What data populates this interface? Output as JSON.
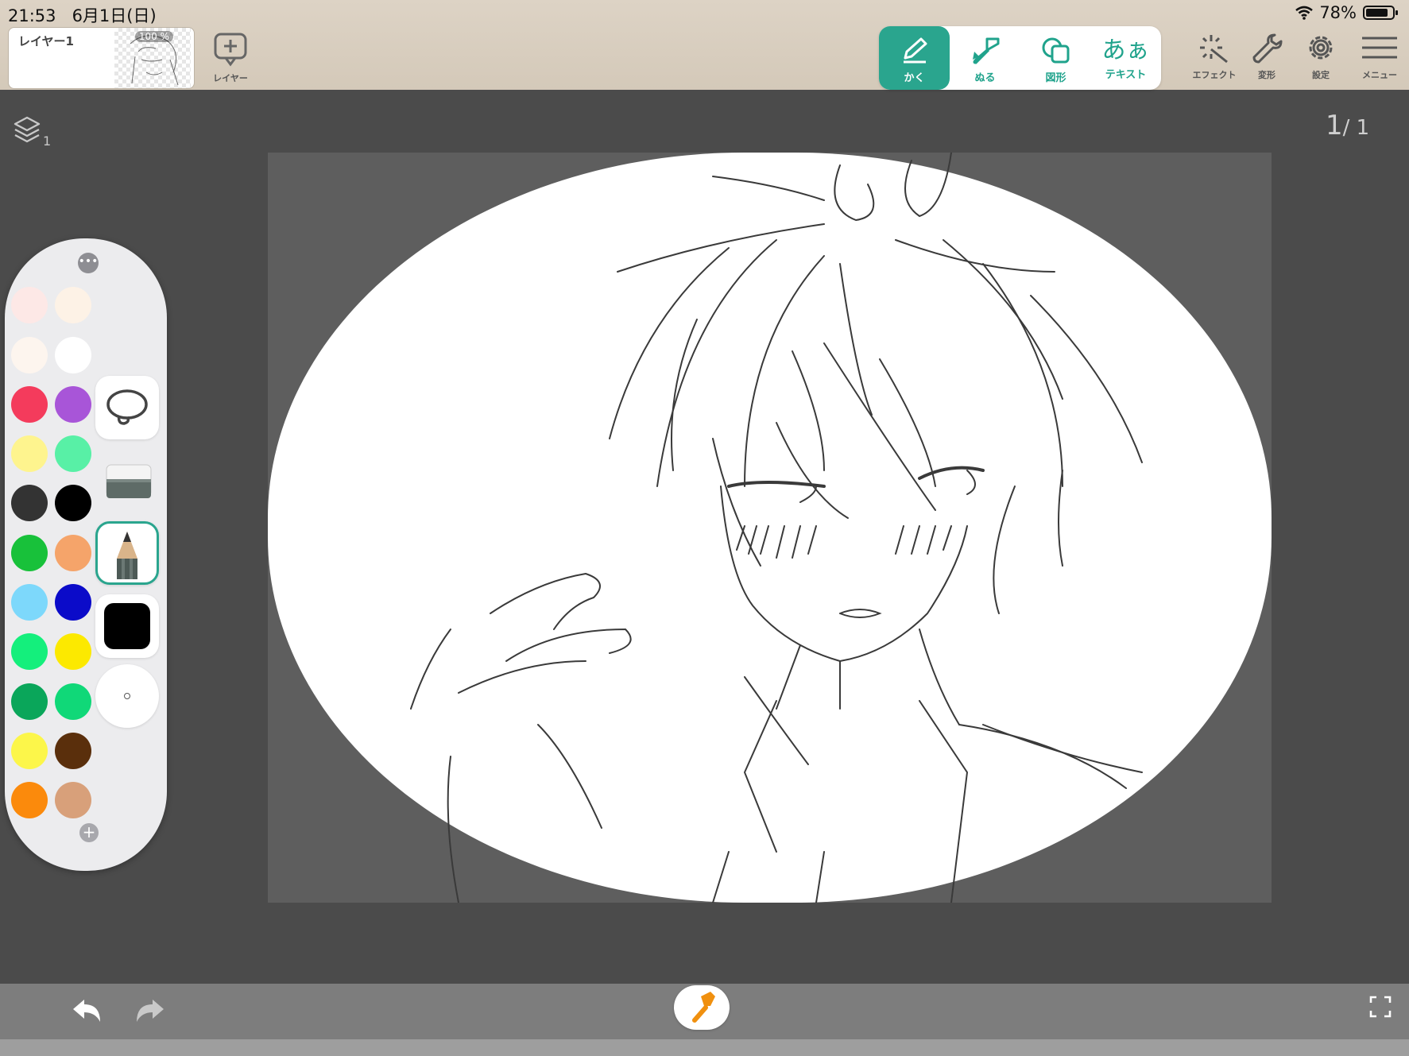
{
  "status_bar": {
    "time": "21:53",
    "date": "6月1日(日)",
    "wifi": "wifi-icon",
    "battery_percent": "78%",
    "battery_level": 0.78
  },
  "layer_panel": {
    "layer_name": "レイヤー1",
    "opacity": "100 %",
    "add_layer_label": "レイヤー"
  },
  "tool_tabs": [
    {
      "label": "かく",
      "icon": "pen-icon",
      "active": true
    },
    {
      "label": "ぬる",
      "icon": "paint-brush-icon",
      "active": false
    },
    {
      "label": "図形",
      "icon": "shapes-icon",
      "active": false
    },
    {
      "label": "テキスト",
      "icon": "text-icon",
      "glyph": "あぁ",
      "active": false
    }
  ],
  "top_actions": [
    {
      "label": "エフェクト",
      "icon": "sparkle-icon"
    },
    {
      "label": "変形",
      "icon": "wrench-icon"
    },
    {
      "label": "設定",
      "icon": "gear-icon"
    },
    {
      "label": "メニュー",
      "icon": "hamburger-icon"
    }
  ],
  "canvas": {
    "layer_count": "1",
    "page_current": "1",
    "page_total": "1"
  },
  "palette": {
    "colors": [
      "#fde8e6",
      "#fdf2e6",
      "#fdf5ee",
      "#ffffff",
      "#f43b5c",
      "#a855d8",
      "#fef48e",
      "#58f0a6",
      "#333333",
      "#000000",
      "#18c13a",
      "#f5a46a",
      "#7dd8fb",
      "#0b0bc9",
      "#14ef7c",
      "#fce900",
      "#0aa65a",
      "#10d878",
      "#fcf64a",
      "#5a2f0c",
      "#fb8a0c",
      "#d8a07a"
    ],
    "tools": [
      "lasso-icon",
      "eraser-icon",
      "pencil-icon",
      "current-color-black",
      "brush-size-dot"
    ],
    "selected_tool": "pencil-icon",
    "current_color": "#000000"
  },
  "bottom_bar": {
    "undo": "undo-icon",
    "redo": "redo-icon",
    "quick_tool": "hammer-icon",
    "fullscreen": "fullscreen-icon"
  },
  "colors": {
    "accent": "#2aa58e",
    "topbar": "#d8cdbf",
    "background": "#4b4b4b"
  }
}
